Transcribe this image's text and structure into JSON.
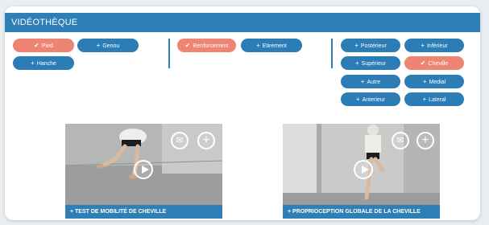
{
  "header": {
    "title": "VIDÉOTHÈQUE"
  },
  "filters": {
    "group1": [
      {
        "label": "Pied",
        "mark": "✔",
        "active": true
      },
      {
        "label": "Genou",
        "mark": "+",
        "active": false
      },
      {
        "label": "Hanche",
        "mark": "+",
        "active": false
      }
    ],
    "group2": [
      {
        "label": "Renforcement",
        "mark": "✔",
        "active": true
      },
      {
        "label": "Etirement",
        "mark": "+",
        "active": false
      }
    ],
    "group3": [
      {
        "label": "Postérieur",
        "mark": "+",
        "active": false
      },
      {
        "label": "Inférieur",
        "mark": "+",
        "active": false
      },
      {
        "label": "Supérieur",
        "mark": "+",
        "active": false
      },
      {
        "label": "Cheville",
        "mark": "✔",
        "active": true
      },
      {
        "label": "Autre",
        "mark": "+",
        "active": false
      },
      {
        "label": "Medial",
        "mark": "+",
        "active": false
      },
      {
        "label": "Anterieur",
        "mark": "+",
        "active": false
      },
      {
        "label": "Lateral",
        "mark": "+",
        "active": false
      }
    ]
  },
  "videos": [
    {
      "title": "+ TEST DE MOBILITÉ DE CHEVILLE"
    },
    {
      "title": "+ PROPRIOCEPTION GLOBALE DE LA CHEVILLE"
    }
  ],
  "colors": {
    "accent": "#2c7db6",
    "active": "#ee8474",
    "header": "#2f7fb7"
  },
  "icons": {
    "mail": "mail-icon",
    "add": "plus-icon",
    "play": "play-icon"
  }
}
